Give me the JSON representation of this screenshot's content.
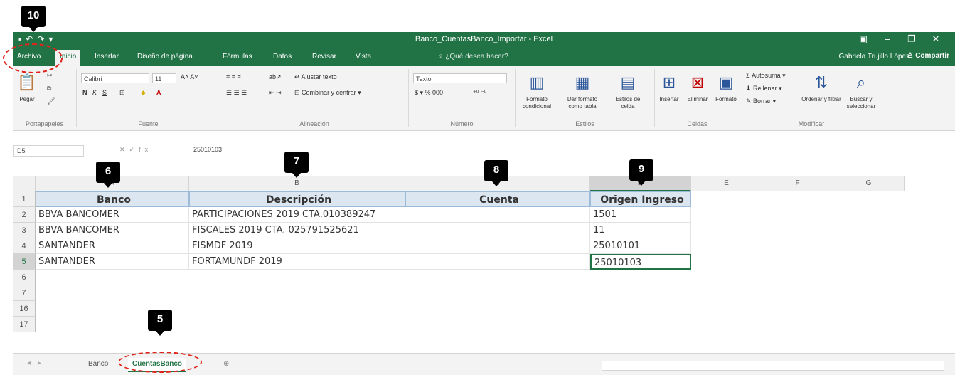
{
  "window": {
    "title": "Banco_CuentasBanco_Importar - Excel",
    "qat_icons": [
      "save-icon",
      "undo-icon",
      "redo-icon",
      "customize-icon"
    ],
    "controls": [
      "ribbon-display-icon",
      "minimize-icon",
      "maximize-icon",
      "close-icon"
    ]
  },
  "tabs": [
    {
      "label": "Archivo"
    },
    {
      "label": "Inicio"
    },
    {
      "label": "Insertar"
    },
    {
      "label": "Diseño de página"
    },
    {
      "label": "Fórmulas"
    },
    {
      "label": "Datos"
    },
    {
      "label": "Revisar"
    },
    {
      "label": "Vista"
    }
  ],
  "tell_me": "¿Qué desea hacer?",
  "user": "Gabriela Trujillo López",
  "share": "Compartir",
  "ribbon": {
    "clipboard": {
      "paste": "Pegar",
      "group": "Portapapeles"
    },
    "font": {
      "name": "Calibri",
      "size": "11",
      "group": "Fuente"
    },
    "alignment": {
      "wrap": "Ajustar texto",
      "merge": "Combinar y centrar",
      "group": "Alineación"
    },
    "number": {
      "format": "Texto",
      "group": "Número"
    },
    "styles": {
      "conditional": "Formato condicional",
      "table": "Dar formato como tabla",
      "cell": "Estilos de celda",
      "group": "Estilos"
    },
    "cells": {
      "insert": "Insertar",
      "delete": "Eliminar",
      "format": "Formato",
      "group": "Celdas"
    },
    "editing": {
      "autosum": "Autosuma",
      "fill": "Rellenar",
      "clear": "Borrar",
      "sort": "Ordenar y filtrar",
      "find": "Buscar y seleccionar",
      "group": "Modificar"
    }
  },
  "formula_bar": {
    "name_box": "D5",
    "value": "25010103"
  },
  "columns": [
    "A",
    "B",
    "C",
    "D",
    "E",
    "F",
    "G"
  ],
  "rows": [
    "1",
    "2",
    "3",
    "4",
    "5",
    "6",
    "7",
    "16",
    "17"
  ],
  "table": {
    "headers": [
      "Banco",
      "Descripción",
      "Cuenta",
      "Origen Ingreso"
    ],
    "data": [
      [
        "BBVA BANCOMER",
        "PARTICIPACIONES 2019 CTA.010389247",
        "",
        "1501"
      ],
      [
        "BBVA BANCOMER",
        "FISCALES 2019 CTA. 025791525621",
        "",
        "11"
      ],
      [
        "SANTANDER",
        "FISMDF 2019",
        "",
        "25010101"
      ],
      [
        "SANTANDER",
        "FORTAMUNDF 2019",
        "",
        "25010103"
      ]
    ]
  },
  "sheets": [
    "Banco",
    "CuentasBanco"
  ],
  "markers": [
    "10",
    "6",
    "7",
    "8",
    "9",
    "5"
  ]
}
